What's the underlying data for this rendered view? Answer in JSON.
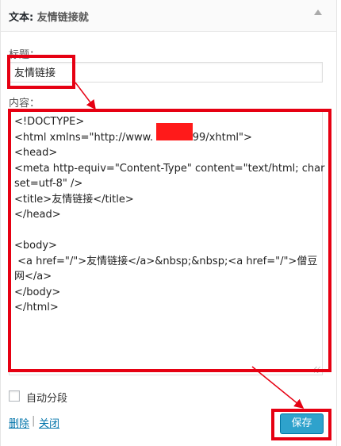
{
  "header": {
    "title": "文本:",
    "subtitle": "友情链接就"
  },
  "form": {
    "title_label": "标题：",
    "title_value": "友情链接",
    "content_label": "内容：",
    "content_value": "<!DOCTYPE>\n<html xmlns=\"http://www.        1999/xhtml\">\n<head>\n<meta http-equiv=\"Content-Type\" content=\"text/html; charset=utf-8\" />\n<title>友情链接</title>\n</head>\n\n<body>\n <a href=\"/\">友情链接</a>&nbsp;&nbsp;<a href=\"/\">僧豆网</a>\n</body>\n</html>",
    "autop_label": "自动分段"
  },
  "actions": {
    "delete_label": "删除",
    "separator": "|",
    "close_label": "关闭",
    "save_label": "保存"
  },
  "colors": {
    "highlight": "#e60012",
    "redaction": "#ff1a1a",
    "primary_button": "#2ea2cc",
    "link": "#0073aa"
  }
}
